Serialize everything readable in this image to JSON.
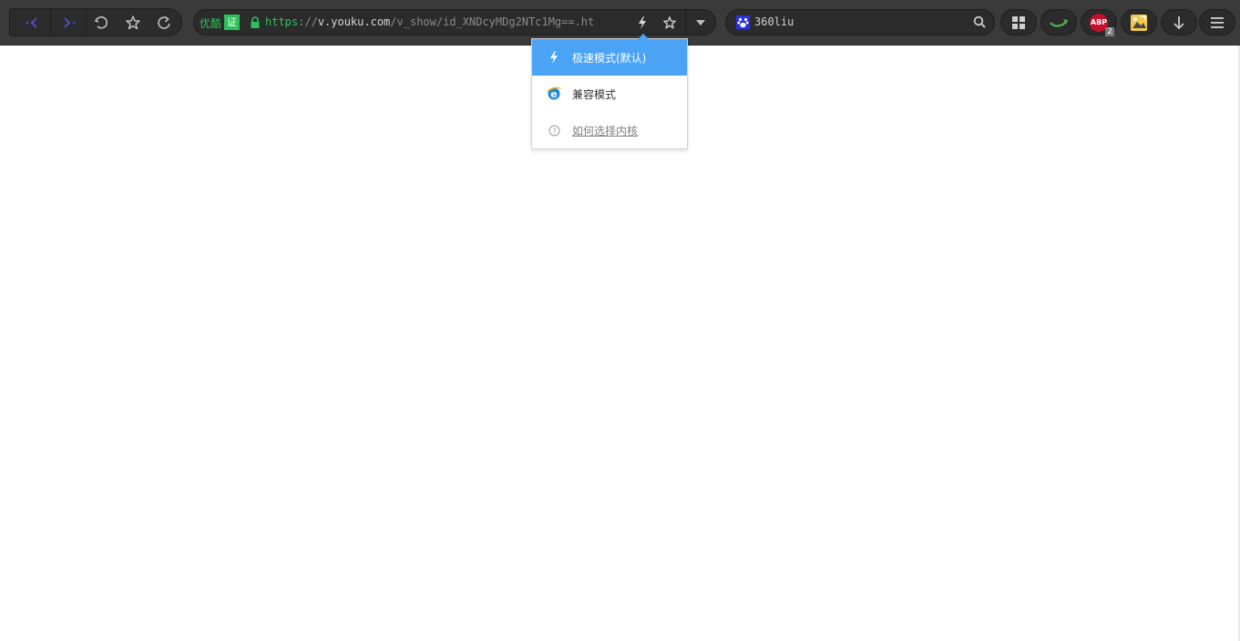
{
  "toolbar": {
    "back_label": "Back",
    "forward_label": "Forward",
    "undo_close_label": "Restore closed tab",
    "favorites_label": "Favorites",
    "reload_label": "Reload"
  },
  "address_bar": {
    "cert_name": "优酷",
    "cert_badge": "证",
    "url_scheme": "https",
    "url_sep": "://",
    "url_host": "v.youku.com",
    "url_path": "/v_show/id_XNDcyMDg2NTc1Mg==.ht",
    "icons": [
      "lock-icon",
      "lightning-icon",
      "star-icon",
      "dropdown-arrow-icon"
    ]
  },
  "search_bar": {
    "value": "360liu",
    "engine_icon": "baidu-paw-icon"
  },
  "extensions": {
    "abp_label": "ABP",
    "abp_badge": "2",
    "icons": [
      "apps-grid-icon",
      "mouse-gesture-icon",
      "adblock-plus-icon",
      "photo-extension-icon",
      "download-icon",
      "menu-icon"
    ]
  },
  "kernel_menu": {
    "items": [
      {
        "label": "极速模式(默认)",
        "icon": "lightning-icon",
        "selected": true
      },
      {
        "label": "兼容模式",
        "icon": "ie-icon",
        "selected": false
      },
      {
        "label": "如何选择内核",
        "icon": "help-icon",
        "selected": false
      }
    ]
  },
  "colors": {
    "toolbar_bg": "#3a3a3a",
    "secure_green": "#2fbf5a",
    "menu_highlight": "#4aa3f5",
    "nav_arrow_purple": "#5b4fd6"
  }
}
